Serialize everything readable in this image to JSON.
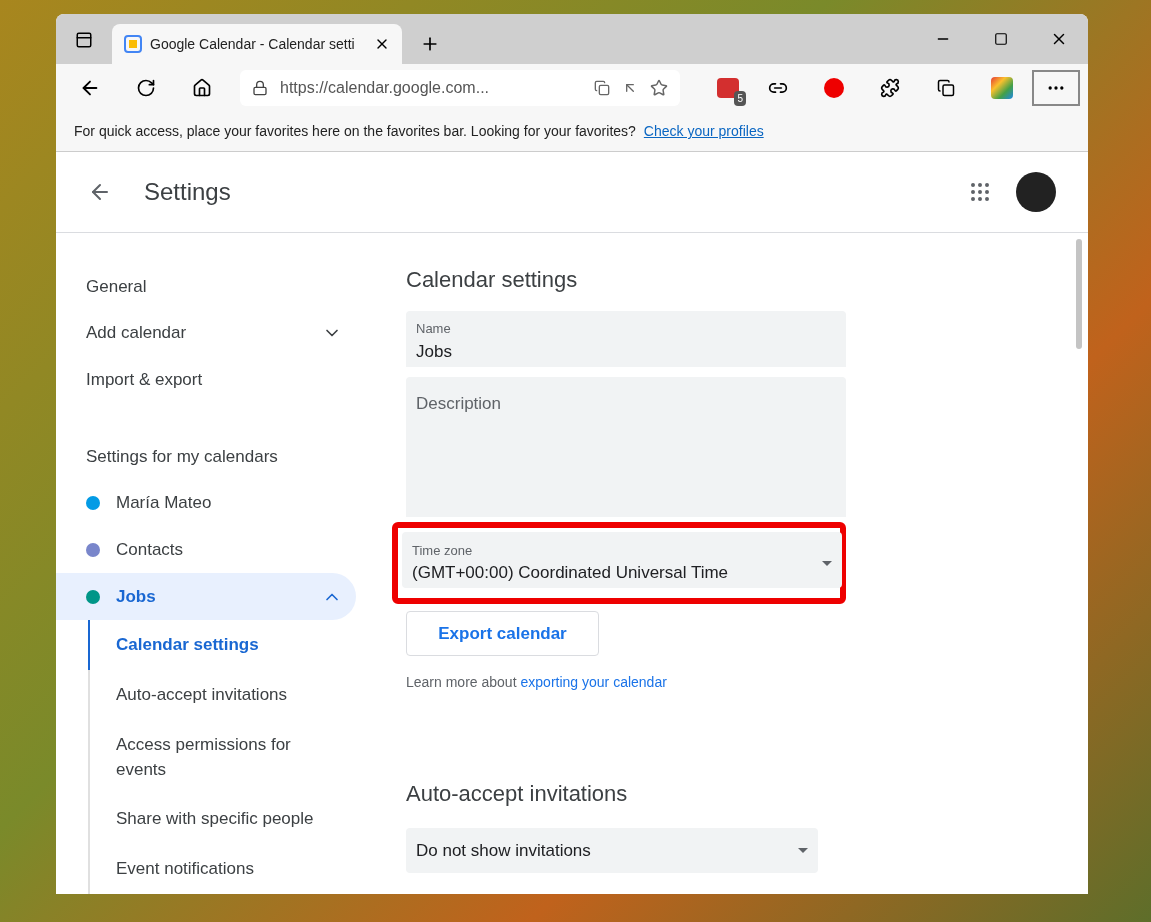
{
  "browser": {
    "tab_title": "Google Calendar - Calendar setti",
    "url": "https://calendar.google.com...",
    "extension_badge": "5",
    "favorites_message": "For quick access, place your favorites here on the favorites bar. Looking for your favorites?",
    "favorites_link": "Check your profiles"
  },
  "header": {
    "title": "Settings"
  },
  "sidebar": {
    "items": [
      {
        "label": "General",
        "expandable": false
      },
      {
        "label": "Add calendar",
        "expandable": true
      },
      {
        "label": "Import & export",
        "expandable": false
      }
    ],
    "calendars_heading": "Settings for my calendars",
    "calendars": [
      {
        "name": "María Mateo",
        "color": "#039be5",
        "selected": false,
        "expanded": false
      },
      {
        "name": "Contacts",
        "color": "#7986cb",
        "selected": false,
        "expanded": false
      },
      {
        "name": "Jobs",
        "color": "#009688",
        "selected": true,
        "expanded": true
      }
    ],
    "subitems": [
      {
        "label": "Calendar settings",
        "selected": true
      },
      {
        "label": "Auto-accept invitations",
        "selected": false
      },
      {
        "label": "Access permissions for events",
        "selected": false
      },
      {
        "label": "Share with specific people",
        "selected": false
      },
      {
        "label": "Event notifications",
        "selected": false
      }
    ]
  },
  "main": {
    "section_title": "Calendar settings",
    "name_field": {
      "label": "Name",
      "value": "Jobs"
    },
    "description_field": {
      "placeholder": "Description"
    },
    "timezone_field": {
      "label": "Time zone",
      "value": "(GMT+00:00) Coordinated Universal Time",
      "highlighted": true
    },
    "export_button": "Export calendar",
    "learn_more": {
      "text": "Learn more about",
      "link": "exporting your calendar"
    },
    "section2_title": "Auto-accept invitations",
    "invitations_select": {
      "value": "Do not show invitations"
    }
  }
}
